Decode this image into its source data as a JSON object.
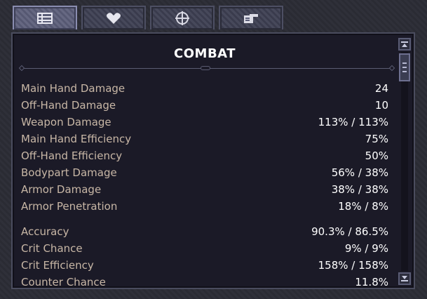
{
  "tabs": [
    {
      "icon": "list-icon",
      "active": true
    },
    {
      "icon": "heart-icon",
      "active": false
    },
    {
      "icon": "crosshair-icon",
      "active": false
    },
    {
      "icon": "pointing-hand-icon",
      "active": false
    }
  ],
  "panel": {
    "title": "COMBAT"
  },
  "stats": {
    "group1": [
      {
        "label": "Main Hand Damage",
        "value": "24"
      },
      {
        "label": "Off-Hand Damage",
        "value": "10"
      },
      {
        "label": "Weapon Damage",
        "value": "113% / 113%"
      },
      {
        "label": "Main Hand Efficiency",
        "value": "75%"
      },
      {
        "label": "Off-Hand Efficiency",
        "value": "50%"
      },
      {
        "label": "Bodypart Damage",
        "value": "56% / 38%"
      },
      {
        "label": "Armor Damage",
        "value": "38% / 38%"
      },
      {
        "label": "Armor Penetration",
        "value": "18% / 8%"
      }
    ],
    "group2": [
      {
        "label": "Accuracy",
        "value": "90.3% / 86.5%"
      },
      {
        "label": "Crit Chance",
        "value": "9% / 9%"
      },
      {
        "label": "Crit Efficiency",
        "value": "158% / 158%"
      },
      {
        "label": "Counter Chance",
        "value": "11.8%"
      }
    ]
  },
  "colors": {
    "label": "#c8b7a6",
    "value": "#ffffff",
    "panel_bg": "#1b1a27"
  }
}
